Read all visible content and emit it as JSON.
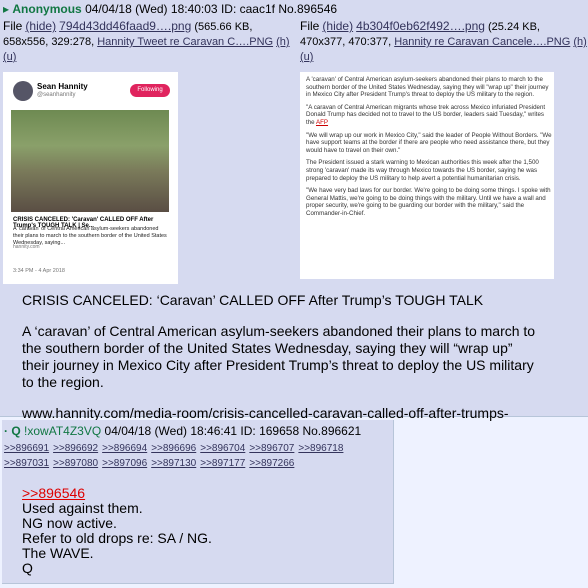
{
  "post1": {
    "marker": "▸",
    "name": "Anonymous",
    "datetime": "04/04/18 (Wed) 18:40:03",
    "id_text": "ID: caac1f",
    "no_text": "No.896546",
    "file1": {
      "label": "File",
      "hide": "(hide)",
      "filename": "794d43dd46faad9….png",
      "info_a": "(565.66 KB,",
      "info_b": "658x556, 329:278,",
      "orig_name": "Hannity Tweet re Caravan C….PNG",
      "h": "(h)",
      "u": "(u)"
    },
    "file2": {
      "label": "File",
      "hide": "(hide)",
      "filename": "4b304f0eb62f492….png",
      "info_a": "(25.24 KB,",
      "info_b": "470x377, 470:377,",
      "orig_name": "Hannity re Caravan Cancele….PNG",
      "h": "(h)",
      "u": "(u)"
    },
    "thumb1": {
      "account_name": "Sean Hannity",
      "handle": "@seanhannity",
      "follow": "Following",
      "card_title": "CRISIS CANCELED: 'Caravan' CALLED OFF After Trump's TOUGH TALK | Se...",
      "card_text": "A 'caravan' of Central American asylum-seekers abandoned their plans to march to the southern border of the United States Wednesday, saying...",
      "card_url": "hannity.com",
      "date": "3:34 PM - 4 Apr 2018"
    },
    "thumb2": {
      "p1": "A 'caravan' of Central American asylum-seekers abandoned their plans to march to the southern border of the United States Wednesday, saying they will \"wrap up\" their journey in Mexico City after President Trump's threat to deploy the US military to the region.",
      "p2_pre": "\"A caravan of Central American migrants whose trek across Mexico infuriated President Donald Trump has decided not to travel to the US border, leaders said Tuesday,\" writes the ",
      "p2_afp": "AFP",
      "p3": "\"We will wrap up our work in Mexico City,\" said the leader of People Without Borders. \"We have support teams at the border if there are people who need assistance there, but they would have to travel on their own.\"",
      "p4": "The President issued a stark warning to Mexican authorities this week after the 1,500 strong 'caravan' made its way through Mexico towards the US border, saying he was prepared to deploy the US military to help avert a potential humanitarian crisis.",
      "p5": "\"We have very bad laws for our border. We're going to be doing some things. I spoke with General Mattis, we're going to be doing things with the military. Until we have a wall and proper security, we're going to be guarding our border with the military,\" said the Commander-in-Chief."
    },
    "body": {
      "line1": "CRISIS CANCELED: ‘Caravan’ CALLED OFF After Trump’s TOUGH TALK",
      "para": "A ‘caravan’ of Central American asylum-seekers abandoned their plans to march to the southern border of the United States Wednesday, saying they will “wrap up” their journey in Mexico City after President Trump’s threat to deploy the US military to the region.",
      "url": "www.hannity.com/media-room/crisis-cancelled-caravan-called-off-after-trumps-tough-talk/"
    }
  },
  "post2": {
    "marker": "·",
    "name": "Q",
    "trip": "!xowAT4Z3VQ",
    "datetime": "04/04/18 (Wed) 18:46:41",
    "id_text": "ID: 169658",
    "no_text": "No.896621",
    "backlinks_row1": [
      ">>896691",
      ">>896692",
      ">>896694",
      ">>896696",
      ">>896704",
      ">>896707",
      ">>896718"
    ],
    "backlinks_row2": [
      ">>897031",
      ">>897080",
      ">>897096",
      ">>897130",
      ">>897177",
      ">>897266"
    ],
    "quote": ">>896546",
    "lines": [
      "Used against them.",
      "NG now active.",
      "Refer to old drops re: SA / NG.",
      "The WAVE.",
      "Q"
    ]
  },
  "colors": {
    "post_bg": "#d6daf0",
    "page_bg": "#eef2ff",
    "name_green": "#117743",
    "link": "#34345c",
    "quote_red": "#d00000"
  }
}
